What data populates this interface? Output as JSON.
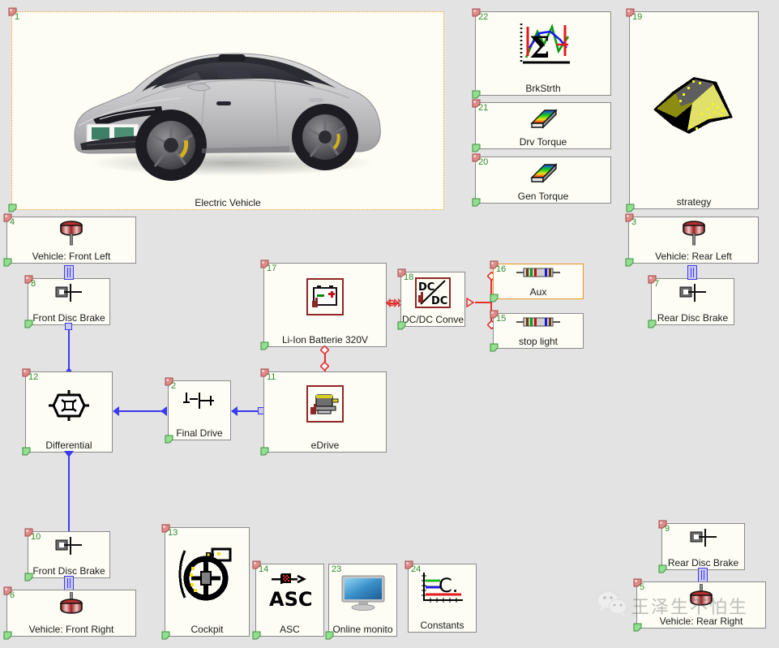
{
  "canvas": {
    "background": "#e3e3e3",
    "block_fill": "#fdfdf5",
    "block_border": "#8a8a8a",
    "selection_color": "#f0921e",
    "number_color": "#2e8b2e",
    "signal_wire_color": "#3a3af0",
    "electric_wire_color": "#e23030"
  },
  "watermark": {
    "text": "王泽生不怕生",
    "logo": "wechat-icon"
  },
  "blocks": [
    {
      "id": "1",
      "label": "Electric Vehicle",
      "icon": "electric-car-photo",
      "selected": true
    },
    {
      "id": "22",
      "label": "BrkStrth",
      "icon": "sigma-curves-icon",
      "selected": false
    },
    {
      "id": "21",
      "label": "Drv Torque",
      "icon": "colormap-table-icon",
      "selected": false
    },
    {
      "id": "20",
      "label": "Gen Torque",
      "icon": "colormap-table-icon",
      "selected": false
    },
    {
      "id": "19",
      "label": "strategy",
      "icon": "statechart-icon",
      "selected": false
    },
    {
      "id": "4",
      "label": "Vehicle: Front Left",
      "icon": "wheel-icon",
      "selected": false
    },
    {
      "id": "3",
      "label": "Vehicle: Rear Left",
      "icon": "wheel-icon",
      "selected": false
    },
    {
      "id": "8",
      "label": "Front Disc Brake",
      "icon": "disc-brake-icon",
      "selected": false
    },
    {
      "id": "7",
      "label": "Rear Disc Brake",
      "icon": "disc-brake-icon",
      "selected": false
    },
    {
      "id": "17",
      "label": "Li-Ion Batterie 320V",
      "icon": "battery-icon",
      "selected": false
    },
    {
      "id": "18",
      "label": "DC/DC Conve",
      "icon": "dcdc-converter-icon",
      "selected": false
    },
    {
      "id": "16",
      "label": "Aux",
      "icon": "resistor-icon",
      "selected": true
    },
    {
      "id": "15",
      "label": "stop light",
      "icon": "resistor-icon",
      "selected": false
    },
    {
      "id": "12",
      "label": "Differential",
      "icon": "differential-icon",
      "selected": false
    },
    {
      "id": "2",
      "label": "Final Drive",
      "icon": "final-drive-icon",
      "selected": false
    },
    {
      "id": "11",
      "label": "eDrive",
      "icon": "motor-icon",
      "selected": false
    },
    {
      "id": "10",
      "label": "Front Disc Brake",
      "icon": "disc-brake-icon",
      "selected": false
    },
    {
      "id": "6",
      "label": "Vehicle: Front Right",
      "icon": "wheel-icon",
      "selected": false
    },
    {
      "id": "9",
      "label": "Rear Disc Brake",
      "icon": "disc-brake-icon",
      "selected": false
    },
    {
      "id": "5",
      "label": "Vehicle: Rear Right",
      "icon": "wheel-icon",
      "selected": false
    },
    {
      "id": "13",
      "label": "Cockpit",
      "icon": "steering-wheel-icon",
      "selected": false
    },
    {
      "id": "14",
      "label": "ASC",
      "icon": "asc-icon",
      "selected": false
    },
    {
      "id": "23",
      "label": "Online monito",
      "icon": "monitor-icon",
      "selected": false
    },
    {
      "id": "24",
      "label": "Constants",
      "icon": "constants-chart-icon",
      "selected": false
    }
  ]
}
